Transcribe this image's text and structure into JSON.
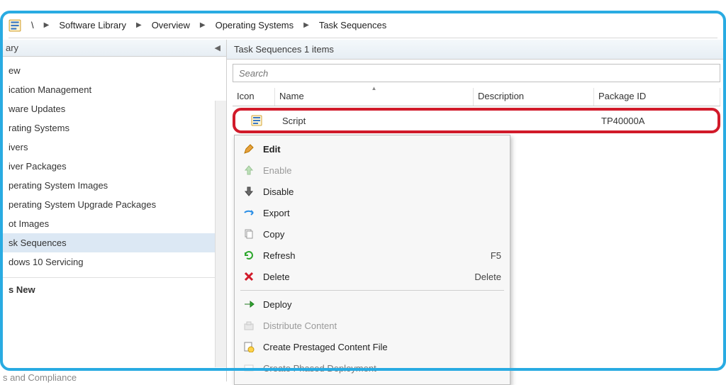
{
  "breadcrumb": {
    "root": "\\",
    "items": [
      "Software Library",
      "Overview",
      "Operating Systems",
      "Task Sequences"
    ]
  },
  "sidebar": {
    "header": "ary",
    "items": [
      {
        "label": "ew",
        "selected": false
      },
      {
        "label": "ication Management",
        "selected": false
      },
      {
        "label": "ware Updates",
        "selected": false
      },
      {
        "label": "rating Systems",
        "selected": false
      },
      {
        "label": "ivers",
        "selected": false
      },
      {
        "label": "iver Packages",
        "selected": false
      },
      {
        "label": "perating System Images",
        "selected": false
      },
      {
        "label": "perating System Upgrade Packages",
        "selected": false
      },
      {
        "label": "ot Images",
        "selected": false
      },
      {
        "label": "sk Sequences",
        "selected": true
      },
      {
        "label": "dows 10 Servicing",
        "selected": false
      }
    ],
    "group_label": "s New"
  },
  "content": {
    "header": "Task Sequences 1 items",
    "search_placeholder": "Search",
    "columns": {
      "icon": "Icon",
      "name": "Name",
      "desc": "Description",
      "pkg": "Package ID"
    },
    "row": {
      "name": "Script",
      "desc": "",
      "pkg": "TP40000A"
    }
  },
  "context_menu": {
    "edit": "Edit",
    "enable": "Enable",
    "disable": "Disable",
    "export": "Export",
    "copy": "Copy",
    "refresh": "Refresh",
    "refresh_accel": "F5",
    "delete": "Delete",
    "delete_accel": "Delete",
    "deploy": "Deploy",
    "distribute": "Distribute Content",
    "prestaged": "Create Prestaged Content File",
    "phased": "Create Phased Deployment"
  },
  "footer_ghost": "s and Compliance"
}
